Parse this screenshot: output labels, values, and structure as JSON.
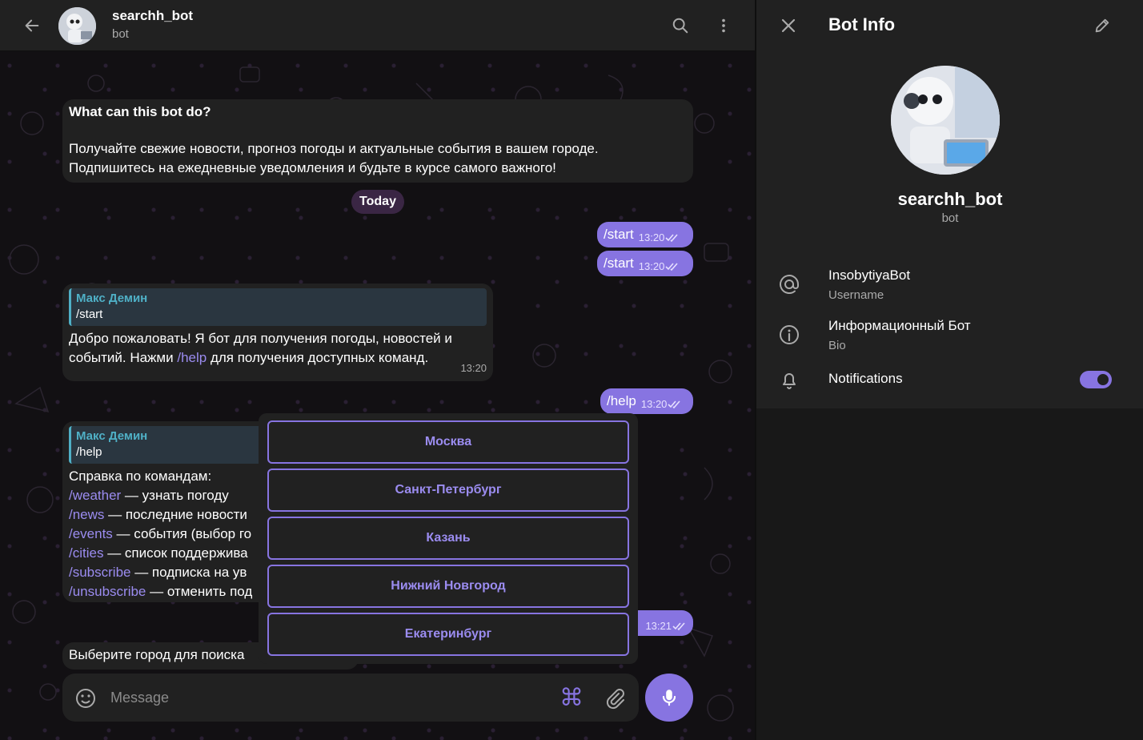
{
  "header": {
    "title": "searchh_bot",
    "subtitle": "bot"
  },
  "intro": {
    "title": "What can this bot do?",
    "line1": "Получайте свежие новости, прогноз погоды и актуальные события в вашем городе.",
    "line2": "Подпишитесь на ежедневные уведомления и будьте в курсе самого важного!"
  },
  "date_chip": "Today",
  "messages": {
    "start1": {
      "text": "/start",
      "time": "13:20"
    },
    "start2": {
      "text": "/start",
      "time": "13:20"
    },
    "welcome": {
      "reply_name": "Макс Демин",
      "reply_text": "/start",
      "line1": "Добро пожаловать! Я бот для получения погоды, новостей и",
      "line2_pre": "событий. Нажми ",
      "line2_cmd": "/help",
      "line2_post": " для получения доступных команд.",
      "time": "13:20"
    },
    "help": {
      "text": "/help",
      "time": "13:20"
    },
    "help_reply": {
      "reply_name": "Макс Демин",
      "reply_text": "/help",
      "heading": "Справка по командам:",
      "commands": [
        {
          "cmd": "/weather",
          "desc": " — узнать погоду"
        },
        {
          "cmd": "/news",
          "desc": " — последние новости"
        },
        {
          "cmd": "/events",
          "desc": " — события (выбор го"
        },
        {
          "cmd": "/cities",
          "desc": " — список поддержива"
        },
        {
          "cmd": "/subscribe",
          "desc": " — подписка на ув"
        },
        {
          "cmd": "/unsubscribe",
          "desc": " — отменить под"
        }
      ]
    },
    "weather_time": "13:21",
    "choose_city": "Выберите город для поиска"
  },
  "keyboard": {
    "buttons": [
      "Москва",
      "Санкт-Петербург",
      "Казань",
      "Нижний Новгород",
      "Екатеринбург"
    ]
  },
  "composer": {
    "placeholder": "Message",
    "command_glyph": "⌘"
  },
  "info_panel": {
    "title": "Bot Info",
    "name": "searchh_bot",
    "role": "bot",
    "username": "InsobytiyaBot",
    "username_label": "Username",
    "bio": "Информационный Бот",
    "bio_label": "Bio",
    "notifications_label": "Notifications",
    "notifications_on": true
  },
  "colors": {
    "accent": "#8774e1",
    "bubble": "#212121",
    "quote": "#4fb0c6",
    "background": "#0e0e10"
  },
  "icons": [
    "back-arrow-icon",
    "search-icon",
    "more-vertical-icon",
    "close-icon",
    "pencil-icon",
    "at-sign-icon",
    "info-icon",
    "bell-icon",
    "smile-icon",
    "command-icon",
    "paperclip-icon",
    "microphone-icon",
    "double-check-icon"
  ]
}
